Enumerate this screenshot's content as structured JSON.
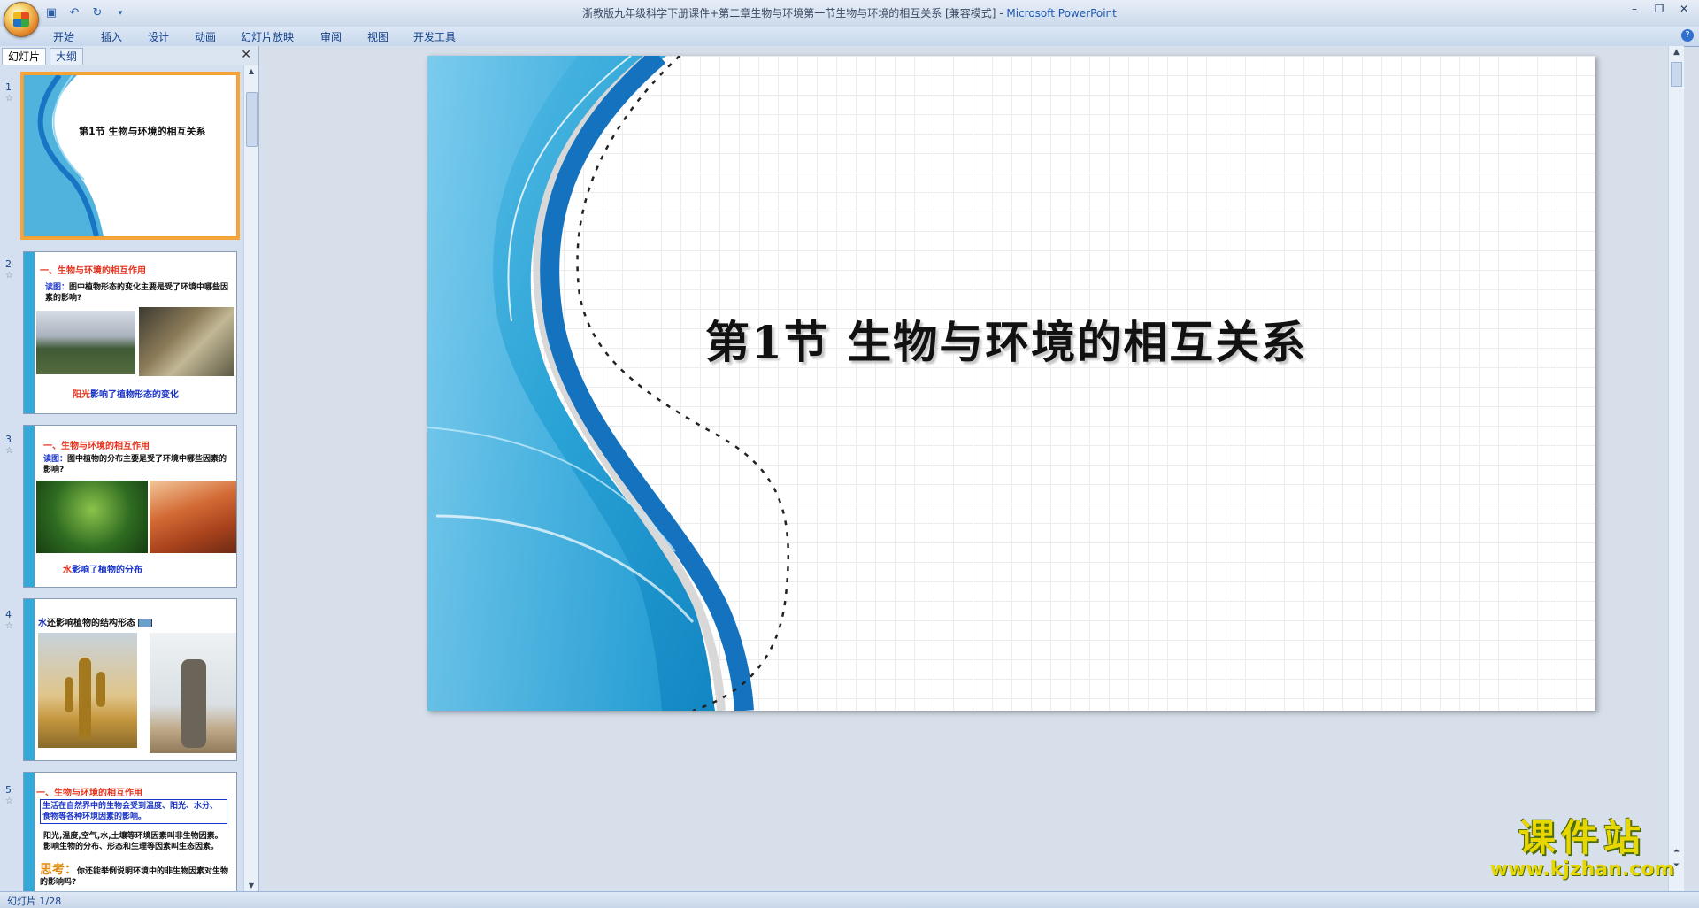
{
  "window": {
    "title_doc": "浙教版九年级科学下册课件+第二章生物与环境第一节生物与环境的相互关系 [兼容模式]",
    "title_sep": " - ",
    "title_app": "Microsoft PowerPoint"
  },
  "ribbon": {
    "tabs": [
      "开始",
      "插入",
      "设计",
      "动画",
      "幻灯片放映",
      "审阅",
      "视图",
      "开发工具"
    ]
  },
  "panel": {
    "tab_slides": "幻灯片",
    "tab_outline": "大纲"
  },
  "thumbnails": [
    {
      "num": "1",
      "title": "第1节  生物与环境的相互关系"
    },
    {
      "num": "2",
      "heading": "一、生物与环境的相互作用",
      "prompt_label": "读图：",
      "prompt": "图中植物形态的变化主要是受了环境中哪些因素的影响?",
      "caption_red": "阳光",
      "caption_blue": "影响了植物形态的变化"
    },
    {
      "num": "3",
      "heading": "一、生物与环境的相互作用",
      "prompt_label": "读图：",
      "prompt": "图中植物的分布主要是受了环境中哪些因素的影响?",
      "caption_red": "水",
      "caption_blue": "影响了植物的分布"
    },
    {
      "num": "4",
      "heading_blue": "水",
      "heading": "还影响植物的结构形态"
    },
    {
      "num": "5",
      "heading": "一、生物与环境的相互作用",
      "box_text": "生活在自然界中的生物会受到温度、阳光、水分、食物等各种环境因素的影响。",
      "body": "阳光,温度,空气,水,土壤等环境因素叫非生物因素。影响生物的分布、形态和生理等因素叫生态因素。",
      "think_label": "思考：",
      "think": "你还能举例说明环境中的非生物因素对生物的影响吗?"
    }
  ],
  "slide": {
    "title": "第1节  生物与环境的相互关系"
  },
  "watermark": {
    "brand": "课件站",
    "url": "www.kjzhan.com"
  },
  "status": {
    "slide_indicator": "幻灯片 1/28"
  }
}
